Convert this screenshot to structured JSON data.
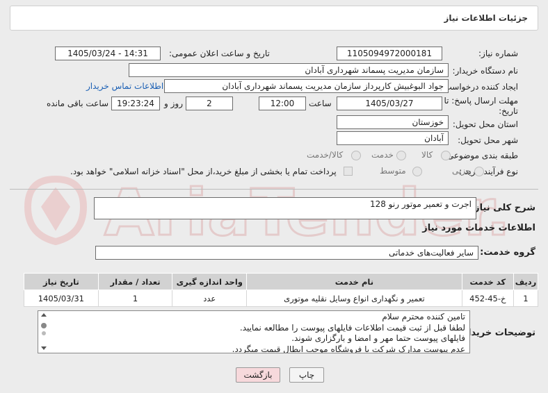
{
  "header": {
    "title": "جزئیات اطلاعات نیاز"
  },
  "fields": {
    "need_number_label": "شماره نیاز:",
    "need_number": "1105094972000181",
    "announce_label": "تاریخ و ساعت اعلان عمومی:",
    "announce_value": "1405/03/24 - 14:31",
    "buyer_org_label": "نام دستگاه خریدار:",
    "buyer_org": "سازمان مدیریت پسماند شهرداری آبادان",
    "creator_label": "ایجاد کننده درخواست:",
    "creator": "جواد البوغبیش کارپرداز سازمان مدیریت پسماند شهرداری آبادان",
    "contact_link": "اطلاعات تماس خریدار",
    "deadline_label_1": "مهلت ارسال پاسخ: تا",
    "deadline_label_2": "تاریخ:",
    "deadline_date": "1405/03/27",
    "time_label": "ساعت",
    "deadline_time": "12:00",
    "days_value": "2",
    "days_label": "روز و",
    "remaining_time": "19:23:24",
    "remaining_label": "ساعت باقی مانده",
    "province_label": "استان محل تحویل:",
    "province": "خوزستان",
    "city_label": "شهر محل تحویل:",
    "city": "آبادان",
    "category_label": "طبقه بندی موضوعی:",
    "category_options": [
      "کالا",
      "خدمت",
      "کالا/خدمت"
    ],
    "process_label": "نوع فرآیند خرید :",
    "process_options": [
      "جزیی",
      "متوسط"
    ],
    "payment_note": "پرداخت تمام یا بخشی از مبلغ خرید،از محل \"اسناد خزانه اسلامی\" خواهد بود."
  },
  "description": {
    "label": "شرح کلی نیاز:",
    "value": "اجرت و تعمیر موتور رنو 128"
  },
  "services": {
    "section_title": "اطلاعات خدمات مورد نیاز",
    "group_label": "گروه خدمت:",
    "group_value": "سایر فعالیت‌های خدماتی"
  },
  "table": {
    "headers": [
      "ردیف",
      "کد خدمت",
      "نام خدمت",
      "واحد اندازه گیری",
      "تعداد / مقدار",
      "تاریخ نیاز"
    ],
    "rows": [
      [
        "1",
        "خ-45-452",
        "تعمیر و نگهداری انواع وسایل نقلیه موتوری",
        "عدد",
        "1",
        "1405/03/31"
      ]
    ]
  },
  "buyer_notes": {
    "label": "توضیحات خریدار:",
    "lines": [
      "تامین کننده محترم سلام",
      "لطفا قبل از ثبت قیمت اطلاعات فایلهای پیوست را مطالعه نمایید.",
      "فایلهای پیوست حتما مهر و امضا و بارگزاری شوند.",
      "عدم پیوست مدارک شرکت یا فروشگاه موجب ابطال قیمت میگردد."
    ]
  },
  "buttons": {
    "print": "چاپ",
    "back": "بازگشت"
  },
  "colors": {
    "back_button_bg": "#f7d9dc",
    "link": "#1a5fb4",
    "watermark": "#e9b9b9"
  }
}
